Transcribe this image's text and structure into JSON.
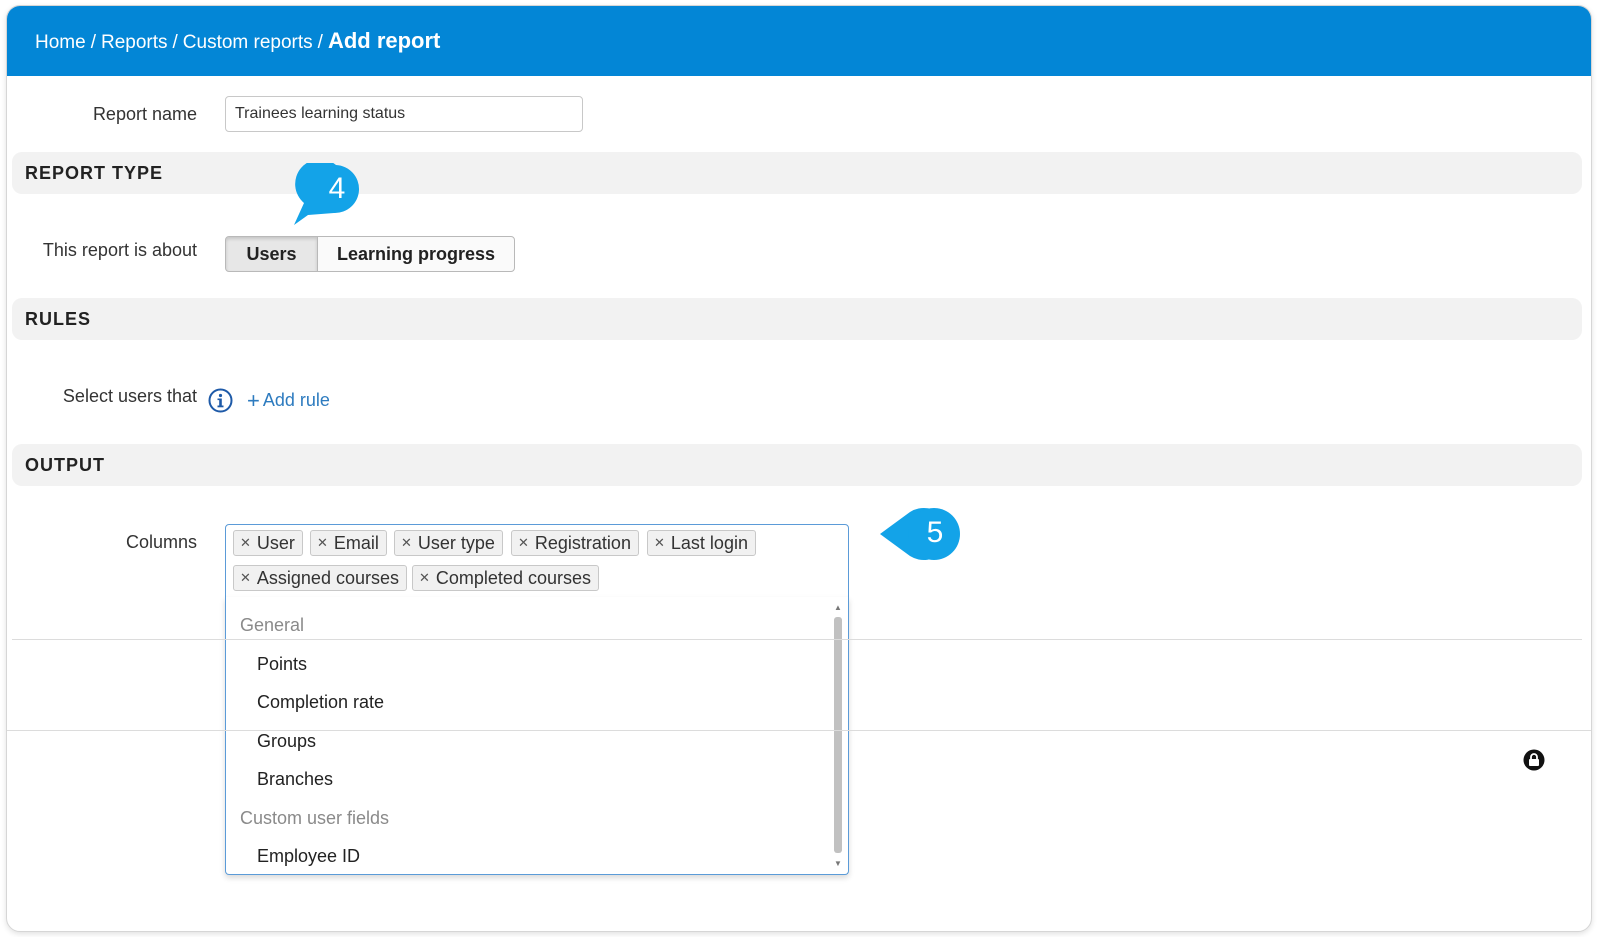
{
  "breadcrumb": {
    "items": [
      "Home",
      "Reports",
      "Custom reports"
    ],
    "separator": "/",
    "current": "Add report"
  },
  "report_name": {
    "label": "Report name",
    "value": "Trainees learning status"
  },
  "sections": {
    "report_type": "REPORT TYPE",
    "rules": "RULES",
    "output": "OUTPUT"
  },
  "report_type": {
    "label": "This report is about",
    "options": [
      "Users",
      "Learning progress"
    ],
    "selected": "Users"
  },
  "rules": {
    "label": "Select users that",
    "add_rule": "Add rule",
    "info_icon": "info-icon"
  },
  "output": {
    "label": "Columns",
    "tags": [
      "User",
      "Email",
      "User type",
      "Registration",
      "Last login",
      "Assigned courses",
      "Completed courses"
    ],
    "dropdown": {
      "groups": [
        {
          "label": "General",
          "items": [
            "Points",
            "Completion rate",
            "Groups",
            "Branches"
          ]
        },
        {
          "label": "Custom user fields",
          "items": [
            "Employee ID"
          ]
        }
      ]
    }
  },
  "callouts": [
    "4",
    "5"
  ],
  "colors": {
    "header": "#0386d6",
    "callout": "#13a3e8",
    "link": "#2d7bbf"
  }
}
